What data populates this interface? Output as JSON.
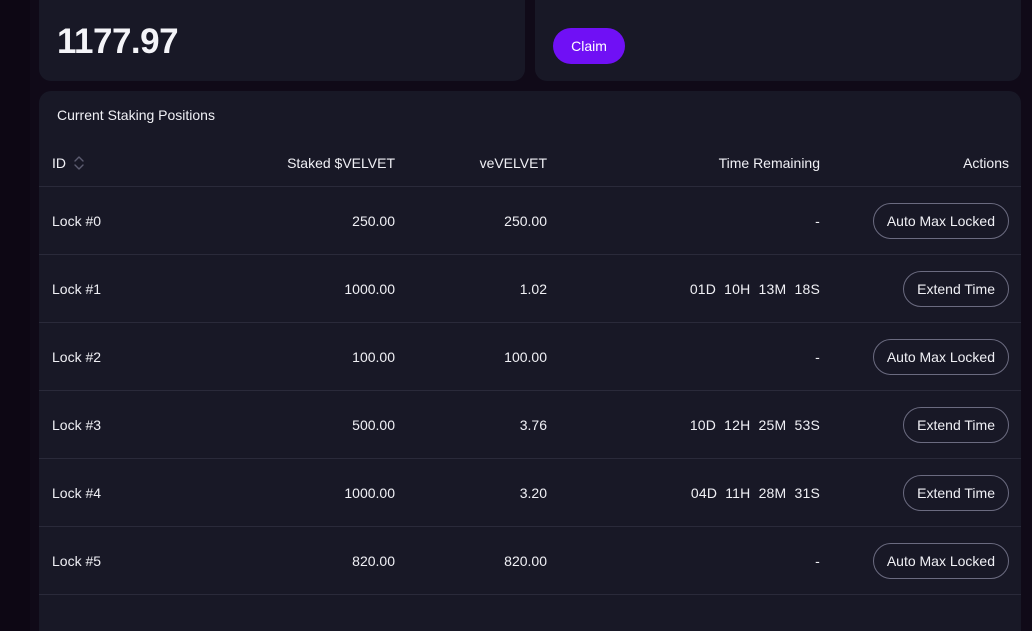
{
  "balance_card": {
    "value": "1177.97"
  },
  "claim_card": {
    "claim_label": "Claim"
  },
  "positions": {
    "title": "Current Staking Positions",
    "headers": {
      "id": "ID",
      "staked": "Staked $VELVET",
      "ve": "veVELVET",
      "time": "Time Remaining",
      "actions": "Actions"
    },
    "rows": [
      {
        "id": "Lock #0",
        "staked": "250.00",
        "ve": "250.00",
        "time": "-",
        "action": "Auto Max Locked"
      },
      {
        "id": "Lock #1",
        "staked": "1000.00",
        "ve": "1.02",
        "time": "01D 10H 13M 18S",
        "action": "Extend Time"
      },
      {
        "id": "Lock #2",
        "staked": "100.00",
        "ve": "100.00",
        "time": "-",
        "action": "Auto Max Locked"
      },
      {
        "id": "Lock #3",
        "staked": "500.00",
        "ve": "3.76",
        "time": "10D 12H 25M 53S",
        "action": "Extend Time"
      },
      {
        "id": "Lock #4",
        "staked": "1000.00",
        "ve": "3.20",
        "time": "04D 11H 28M 31S",
        "action": "Extend Time"
      },
      {
        "id": "Lock #5",
        "staked": "820.00",
        "ve": "820.00",
        "time": "-",
        "action": "Auto Max Locked"
      }
    ]
  },
  "colors": {
    "background": "#100a18",
    "card": "#181826",
    "accent": "#7010f5",
    "divider": "#2a2a3a"
  },
  "icons": {
    "sort": "sort-updown-icon"
  }
}
